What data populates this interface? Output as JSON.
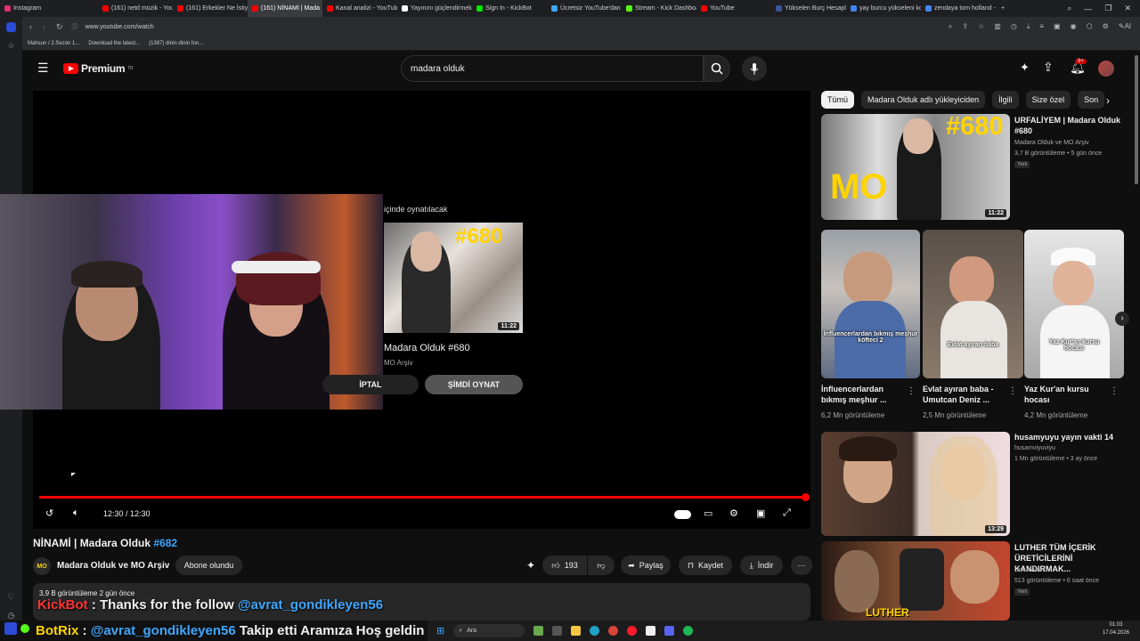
{
  "browser": {
    "tabs": [
      {
        "label": "Instagram",
        "color": "#e1306c"
      },
      {
        "label": "(161) netd müzik - YouTube",
        "color": "#ff0000"
      },
      {
        "label": "(161) Erkekler Ne İstiyor?",
        "color": "#ff0000"
      },
      {
        "label": "(161) NİNAMİ | Mada",
        "color": "#ff0000",
        "active": true
      },
      {
        "label": "Kanal analizi - YouTube St",
        "color": "#ff0000"
      },
      {
        "label": "Yayınını güçlendirmek için",
        "color": "#ffffff"
      },
      {
        "label": "Sign In - KickBot",
        "color": "#00e701"
      },
      {
        "label": "Ücretsiz YouTube'dan MP",
        "color": "#3ea6ff"
      },
      {
        "label": "Stream - Kick Dashboard",
        "color": "#53fc18"
      },
      {
        "label": "YouTube",
        "color": "#ff0000"
      },
      {
        "label": "Yükselen Burç Hesaplamı",
        "color": "#3b5998"
      },
      {
        "label": "yay burcu yükseleni koç",
        "color": "#4285f4"
      },
      {
        "label": "zendaya tom holland - Go",
        "color": "#4285f4"
      }
    ],
    "url": "www.youtube.com/watch",
    "bookmarks": [
      "Mahsun / 2.Sezon 1...",
      "Download the latest...",
      "(1387) dinin dinin fon..."
    ]
  },
  "youtube": {
    "logo": "Premium",
    "logo_suffix": "TR",
    "search_value": "madara olduk",
    "notification_count": "9+"
  },
  "player": {
    "endscreen_label": "içinde oynatılacak",
    "next_video": {
      "title": "Madara Olduk #680",
      "channel": "MO Arşiv",
      "duration": "11:22",
      "number": "#680"
    },
    "cancel_label": "İPTAL",
    "play_now_label": "ŞİMDİ OYNAT",
    "time": "12:30 / 12:30",
    "progress": 1.0
  },
  "video": {
    "title": "NİNAMİ | Madara Olduk ",
    "title_tag": "#682",
    "channel": "Madara Olduk ve MO Arşiv",
    "channel_avatar": "MO",
    "subscribe_label": "Abone olundu",
    "likes": "193",
    "share_label": "Paylaş",
    "save_label": "Kaydet",
    "download_label": "İndir",
    "description_meta": "3,9 B görüntüleme  2 gün önce"
  },
  "chat": {
    "line1_user": "KickBot",
    "line1_text": " : Thanks for the follow ",
    "line1_mention": "@avrat_gondikleyen56",
    "line2_user": "BotRix",
    "line2_sep": " : ",
    "line2_mention": "@avrat_gondikleyen56",
    "line2_text": " Takip etti Aramıza Hoş geldin"
  },
  "sidebar": {
    "chips": [
      "Tümü",
      "Madara Olduk adlı yükleyiciden",
      "İlgili",
      "Size özel",
      "Son"
    ],
    "videos": [
      {
        "title": "URFALİYEM | Madara Olduk #680",
        "channel": "Madara Olduk ve MO Arşiv",
        "meta": "3,7 B görüntüleme • 5 gün önce",
        "badge": "Yeni",
        "duration": "11:22",
        "number": "#680",
        "logo": "MO"
      },
      {
        "title": "husamyuyu yayın vakti 14",
        "channel": "husamviyuviyu",
        "meta": "1 Mn görüntüleme • 3 ay önce",
        "duration": "13:29"
      },
      {
        "title": "LUTHER TÜM İÇERİK ÜRETİCİLERİNİ KANDIRMAK...",
        "channel": "Umur Afan",
        "meta": "513 gör­üntüleme • 6 saat önce",
        "badge": "Yeni",
        "overlay": "LUTHER"
      }
    ],
    "shorts": [
      {
        "title": "İnfluencerlardan bıkmış meşhur ...",
        "views": "6,2 Mn görüntüleme",
        "caption": "İnfluencerlardan bıkmış meşhur köfteci 2"
      },
      {
        "title": "Evlat ayıran baba - Umutcan Deniz ...",
        "views": "2,5 Mn görüntüleme",
        "caption": "Evlat ayıran baba"
      },
      {
        "title": "Yaz Kur'an kursu hocası",
        "views": "4,2 Mn görüntüleme",
        "caption": "Yaz Kur'an kursu hocası"
      }
    ]
  },
  "taskbar": {
    "search_placeholder": "Ara",
    "time": "01:03",
    "date": "17.04.2026"
  }
}
